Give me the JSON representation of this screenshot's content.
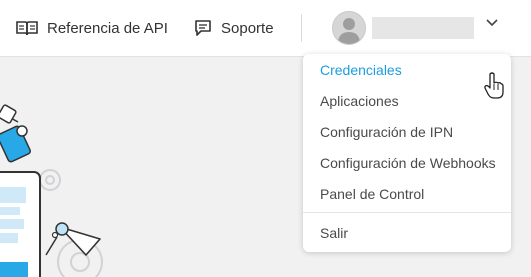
{
  "header": {
    "api_reference_label": "Referencia de API",
    "support_label": "Soporte",
    "api_icon": "book-icon",
    "support_icon": "chat-icon",
    "user_icon": "avatar-icon",
    "menu_toggle_icon": "chevron-down-icon"
  },
  "dropdown": {
    "items": [
      {
        "label": "Credenciales",
        "state": "hover"
      },
      {
        "label": "Aplicaciones"
      },
      {
        "label": "Configuración de IPN"
      },
      {
        "label": "Configuración de Webhooks"
      },
      {
        "label": "Panel de Control"
      }
    ],
    "logout_label": "Salir"
  },
  "colors": {
    "accent": "#1a9ee0",
    "text": "#333333",
    "background": "#f1f1f2"
  }
}
